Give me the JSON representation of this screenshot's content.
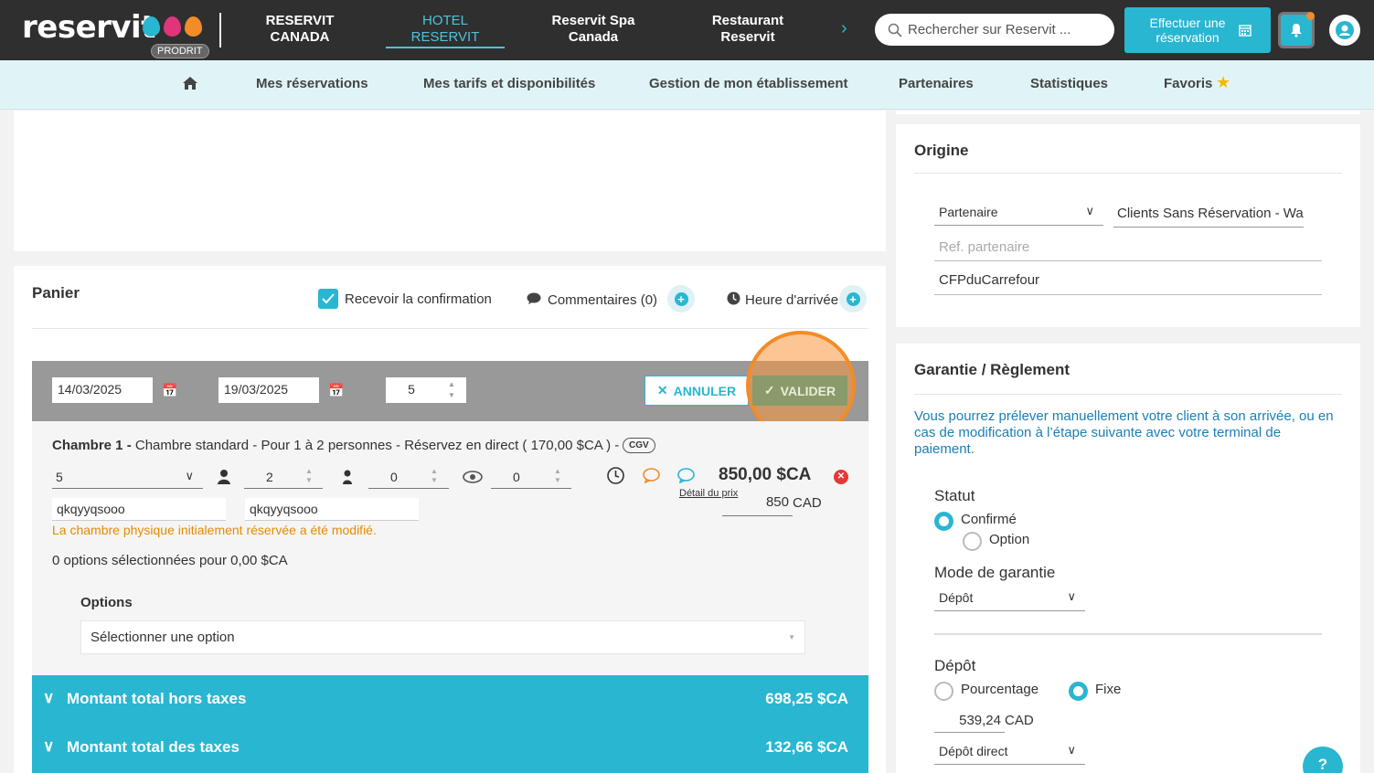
{
  "brand": {
    "name": "reservit",
    "badge": "PRODRIT",
    "dot_colors": [
      "#29b6d1",
      "#e0357a",
      "#f28c28"
    ]
  },
  "topnav": {
    "items": [
      {
        "label": "RESERVIT\nCANADA"
      },
      {
        "label": "HOTEL\nRESERVIT",
        "active": true
      },
      {
        "label": "Reservit Spa\nCanada"
      },
      {
        "label": "Restaurant\nReservit"
      }
    ],
    "search_placeholder": "Rechercher sur Reservit ...",
    "book_button": "Effectuer une réservation"
  },
  "subnav": {
    "items": [
      "Mes réservations",
      "Mes tarifs et disponibilités",
      "Gestion de mon établissement",
      "Partenaires",
      "Statistiques",
      "Favoris"
    ]
  },
  "panier": {
    "title": "Panier",
    "confirm_label": "Recevoir la confirmation",
    "comments_label": "Commentaires (0)",
    "arrival_label": "Heure d'arrivée",
    "date_from": "14/03/2025",
    "date_to": "19/03/2025",
    "nights": "5",
    "cancel_label": "ANNULER",
    "validate_label": "VALIDER",
    "room_title": "Chambre 1 -",
    "room_desc": "Chambre standard - Pour 1 à 2 personnes - Réservez en direct ( 170,00 $CA ) -",
    "cgv": "CGV",
    "room_select": "5",
    "adults": "2",
    "children": "0",
    "babies": "0",
    "price": "850,00 $CA",
    "price_detail": "Détail du prix",
    "price_input": "850",
    "price_currency": "CAD",
    "guest_first": "qkqyyqsooo",
    "guest_last": "qkqyyqsooo",
    "warning": "La chambre physique initialement réservée a été modifié.",
    "options_summary": "0 options sélectionnées pour 0,00 $CA",
    "options_title": "Options",
    "options_placeholder": "Sélectionner une option",
    "total_ht_label": "Montant total hors taxes",
    "total_ht": "698,25 $CA",
    "total_tax_label": "Montant total des taxes",
    "total_tax": "132,66 $CA"
  },
  "origine": {
    "title": "Origine",
    "partner_type": "Partenaire",
    "partner_name": "Clients Sans Réservation - Wa",
    "ref_placeholder": "Ref. partenaire",
    "code": "CFPduCarrefour"
  },
  "garantie": {
    "title": "Garantie / Règlement",
    "info": "Vous pourrez prélever manuellement votre client à son arrivée, ou en cas de modification à l’étape suivante avec votre terminal de paiement.",
    "statut_label": "Statut",
    "statut_confirmed": "Confirmé",
    "statut_option": "Option",
    "mode_label": "Mode de garantie",
    "mode_value": "Dépôt",
    "depot_label": "Dépôt",
    "depot_pct": "Pourcentage",
    "depot_fixed": "Fixe",
    "depot_amount": "539,24",
    "depot_currency": "CAD",
    "depot_type": "Dépôt direct"
  },
  "help_label": "?"
}
